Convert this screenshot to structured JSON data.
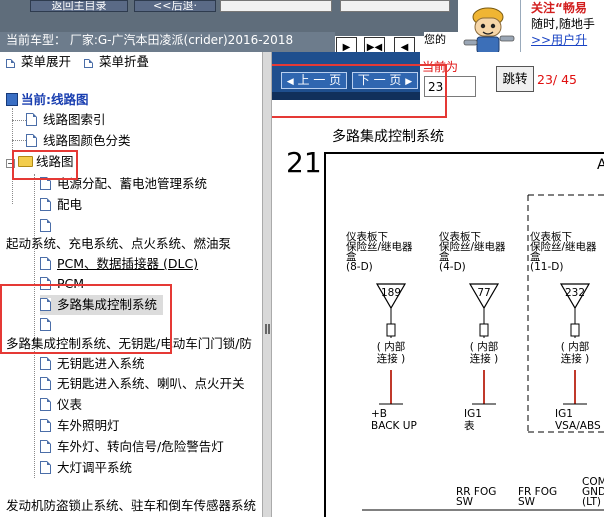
{
  "top_buttons": {
    "home": "返回主目录",
    "back": "<<后退·"
  },
  "car_info": {
    "label": "当前车型：",
    "value": "厂家:G-广汽本田凌派(crider)2016-2018"
  },
  "your_text": "您的",
  "notice": {
    "line1": "关注“畅易",
    "line2": "随时,随地手",
    "link": ">>用户升"
  },
  "tree": {
    "expand_label": "菜单展开",
    "collapse_label": "菜单折叠",
    "current_label": "当前:线路图",
    "items": [
      {
        "label": "线路图索引"
      },
      {
        "label": "线路图颜色分类"
      },
      {
        "label": "线路图"
      },
      {
        "label": "电源分配、蓄电池管理系统"
      },
      {
        "label": "配电"
      },
      {
        "label": ""
      },
      {
        "label": "起动系统、充电系统、点火系统、燃油泵"
      },
      {
        "label": "PCM、数据插接器 (DLC)"
      },
      {
        "label": "PCM"
      },
      {
        "label": "多路集成控制系统"
      },
      {
        "label": ""
      },
      {
        "label": "多路集成控制系统、无钥匙/电动车门门锁/防"
      },
      {
        "label": "无钥匙进入系统"
      },
      {
        "label": "无钥匙进入系统、喇叭、点火开关"
      },
      {
        "label": "仪表"
      },
      {
        "label": "车外照明灯"
      },
      {
        "label": "车外灯、转向信号/危险警告灯"
      },
      {
        "label": "大灯调平系统"
      },
      {
        "label": "发动机防盗锁止系统、驻车和倒车传感器系统"
      }
    ]
  },
  "pager": {
    "prev": "上 一 页",
    "next": "下 一 页",
    "current_label": "当前为",
    "current_page": "23",
    "go": "跳转",
    "count": "23/ 45"
  },
  "diagram": {
    "title": "多路集成控制系统",
    "page_no": "21",
    "corner": "A",
    "fuses": [
      {
        "src": [
          "仪表板下",
          "保险丝/继电器",
          "盒",
          "(8-D)"
        ],
        "num": "189",
        "inner": [
          "( 内部",
          "连接 )"
        ],
        "out": [
          "+B",
          "BACK UP"
        ]
      },
      {
        "src": [
          "仪表板下",
          "保险丝/继电器",
          "盒",
          "(4-D)"
        ],
        "num": "77",
        "inner": [
          "( 内部",
          "连接 )"
        ],
        "out": [
          "IG1",
          "表"
        ]
      },
      {
        "src": [
          "仪表板下",
          "保险丝/继电器",
          "盒",
          "(11-D)"
        ],
        "num": "232",
        "inner": [
          "( 内部",
          "连接 )"
        ],
        "out": [
          "IG1",
          "VSA/ABS"
        ]
      }
    ],
    "bottom": [
      [
        "RR FOG",
        "SW"
      ],
      [
        "FR FOG",
        "SW"
      ],
      [
        "COM",
        "GND",
        "(LT)"
      ]
    ]
  },
  "colors": {
    "wire": "#c0392b",
    "highlight": "#e53935",
    "pager_bg": "#1f4f8e"
  }
}
